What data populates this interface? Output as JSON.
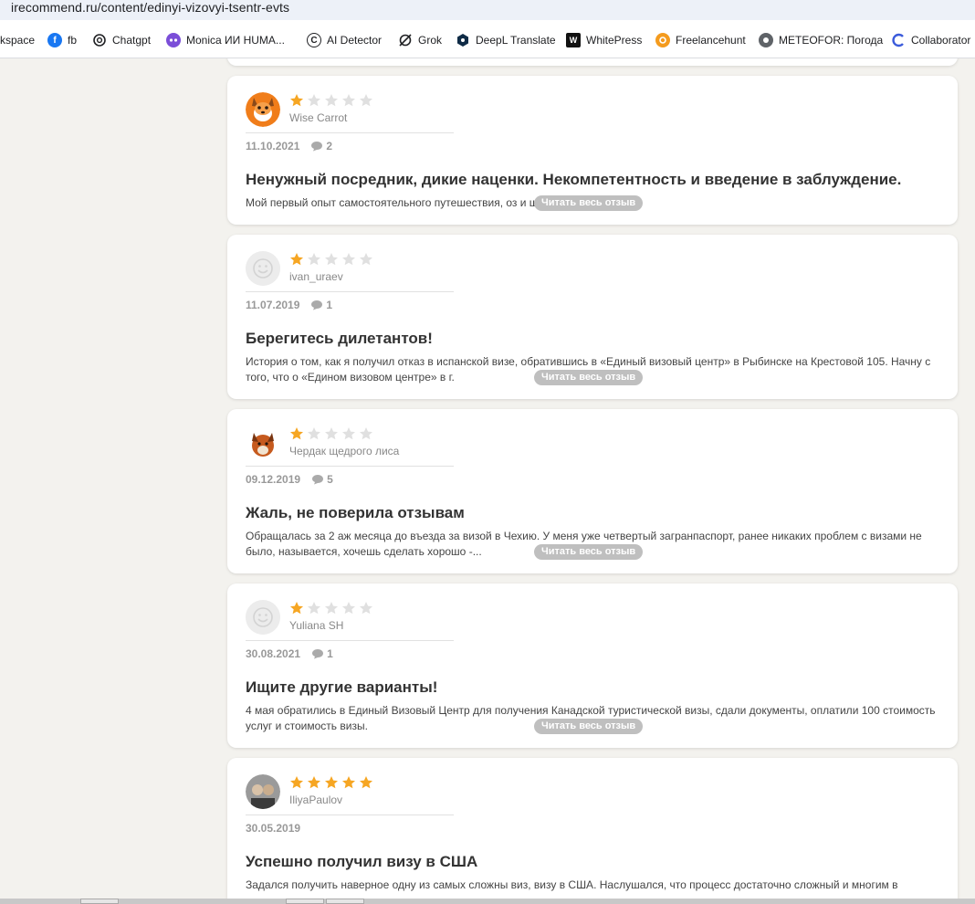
{
  "browser": {
    "url": "irecommend.ru/content/edinyi-vizovyi-tsentr-evts",
    "bookmarks": [
      {
        "label": "kspace",
        "icon": "workspace-icon",
        "color": "#ffffff"
      },
      {
        "label": "fb",
        "icon": "facebook-icon",
        "color": "#1877f2"
      },
      {
        "label": "Chatgpt",
        "icon": "openai-icon",
        "color": "#202124"
      },
      {
        "label": "Monica ИИ HUMA...",
        "icon": "monica-icon",
        "color": "#7b4ed8"
      },
      {
        "label": "AI Detector",
        "icon": "copyright-icon",
        "color": "#202124"
      },
      {
        "label": "Grok",
        "icon": "grok-icon",
        "color": "#202124"
      },
      {
        "label": "DeepL Translate",
        "icon": "deepl-icon",
        "color": "#0f2b46"
      },
      {
        "label": "WhitePress",
        "icon": "whitepress-icon",
        "color": "#d71f26"
      },
      {
        "label": "Freelancehunt",
        "icon": "freelancehunt-icon",
        "color": "#f49b1e"
      },
      {
        "label": "METEOFOR: Погода",
        "icon": "meteofor-icon",
        "color": "#5f6368"
      },
      {
        "label": "Collaborator",
        "icon": "collaborator-icon",
        "color": "#3b5bdb"
      }
    ]
  },
  "reviews": [
    {
      "author": "Wise Carrot",
      "rating": 1,
      "date": "11.10.2021",
      "comments": "2",
      "title": "Ненужный посредник, дикие наценки. Некомпетентность и введение в заблуждение.",
      "excerpt": "Мой первый опыт самостоятельного путешествия, оз                              и шенгена.",
      "avatar": "fox-avatar"
    },
    {
      "author": "ivan_uraev",
      "rating": 1,
      "date": "11.07.2019",
      "comments": "1",
      "title": "Берегитесь дилетантов!",
      "excerpt": "История о том, как я получил отказ в испанской визе, обратившись в «Единый визовый центр» в Рыбинске на Крестовой 105. Начну с того, что о «Едином визовом центре» в г.",
      "avatar": "default-avatar"
    },
    {
      "author": "Чердак щедрого лиса",
      "rating": 1,
      "date": "09.12.2019",
      "comments": "5",
      "title": "Жаль, не поверила отзывам",
      "excerpt": "Обращалась за 2 аж месяца до въезда за визой в Чехию. У меня уже четвертый загранпаспорт, ранее никаких проблем с визами не было, называется, хочешь сделать хорошо -...",
      "avatar": "fox-photo-avatar"
    },
    {
      "author": "Yuliana SH",
      "rating": 1,
      "date": "30.08.2021",
      "comments": "1",
      "title": "Ищите другие варианты!",
      "excerpt": "4 мая обратились в Единый Визовый Центр для получения Канадской туристической визы, сдали документы, оплатили 100 стоимость услуг и стоимость визы.",
      "avatar": "default-avatar"
    },
    {
      "author": "IliyaPaulov",
      "rating": 5,
      "date": "30.05.2019",
      "comments": "",
      "title": "Успешно получил визу в США",
      "excerpt": "Задался получить наверное одну из самых сложны виз, визу в США. Наслушался, что процесс достаточно сложный и многим в",
      "avatar": "photo-avatar"
    }
  ],
  "read_more_label": "Читать весь отзыв",
  "colors": {
    "star_filled": "#f6a623",
    "star_empty": "#e0e0e0",
    "read_more_bg": "#bfbfbf",
    "page_bg": "#f3f2ee"
  }
}
